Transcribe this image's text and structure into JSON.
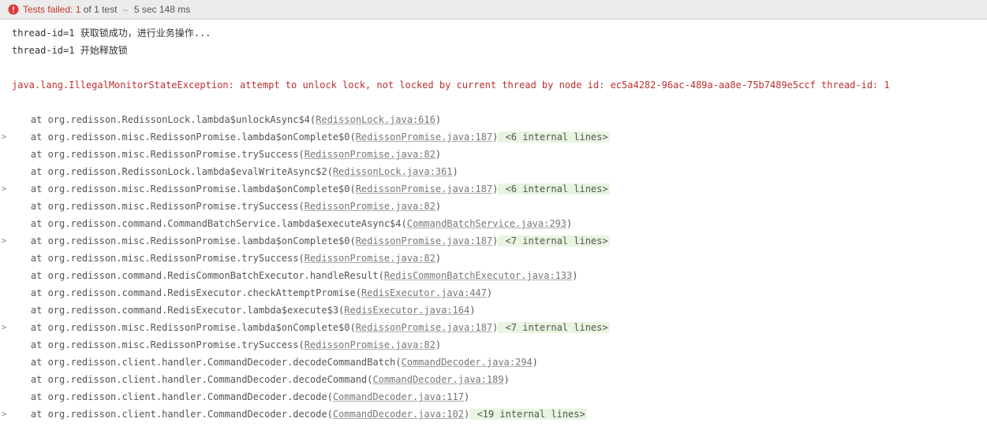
{
  "header": {
    "failed_label": "Tests failed:",
    "failed_count": "1",
    "of_label": "of 1 test",
    "time": "5 sec 148 ms"
  },
  "logs": [
    "thread-id=1 获取锁成功，进行业务操作...",
    "thread-id=1 开始释放锁"
  ],
  "exception": "java.lang.IllegalMonitorStateException: attempt to unlock lock, not locked by current thread by node id: ec5a4282-96ac-489a-aa8e-75b7489e5ccf thread-id: 1",
  "trace": [
    {
      "indent": "    ",
      "expand": "",
      "method": "at org.redisson.RedissonLock.lambda$unlockAsync$4(",
      "link": "RedissonLock.java:616",
      "after": ")",
      "internal": ""
    },
    {
      "indent": "    ",
      "expand": ">",
      "method": "at org.redisson.misc.RedissonPromise.lambda$onComplete$0(",
      "link": "RedissonPromise.java:187",
      "after": ")",
      "internal": " <6 internal lines>"
    },
    {
      "indent": "    ",
      "expand": "",
      "method": "at org.redisson.misc.RedissonPromise.trySuccess(",
      "link": "RedissonPromise.java:82",
      "after": ")",
      "internal": ""
    },
    {
      "indent": "    ",
      "expand": "",
      "method": "at org.redisson.RedissonLock.lambda$evalWriteAsync$2(",
      "link": "RedissonLock.java:361",
      "after": ")",
      "internal": ""
    },
    {
      "indent": "    ",
      "expand": ">",
      "method": "at org.redisson.misc.RedissonPromise.lambda$onComplete$0(",
      "link": "RedissonPromise.java:187",
      "after": ")",
      "internal": " <6 internal lines>"
    },
    {
      "indent": "    ",
      "expand": "",
      "method": "at org.redisson.misc.RedissonPromise.trySuccess(",
      "link": "RedissonPromise.java:82",
      "after": ")",
      "internal": ""
    },
    {
      "indent": "    ",
      "expand": "",
      "method": "at org.redisson.command.CommandBatchService.lambda$executeAsync$4(",
      "link": "CommandBatchService.java:293",
      "after": ")",
      "internal": ""
    },
    {
      "indent": "    ",
      "expand": ">",
      "method": "at org.redisson.misc.RedissonPromise.lambda$onComplete$0(",
      "link": "RedissonPromise.java:187",
      "after": ")",
      "internal": " <7 internal lines>"
    },
    {
      "indent": "    ",
      "expand": "",
      "method": "at org.redisson.misc.RedissonPromise.trySuccess(",
      "link": "RedissonPromise.java:82",
      "after": ")",
      "internal": ""
    },
    {
      "indent": "    ",
      "expand": "",
      "method": "at org.redisson.command.RedisCommonBatchExecutor.handleResult(",
      "link": "RedisCommonBatchExecutor.java:133",
      "after": ")",
      "internal": ""
    },
    {
      "indent": "    ",
      "expand": "",
      "method": "at org.redisson.command.RedisExecutor.checkAttemptPromise(",
      "link": "RedisExecutor.java:447",
      "after": ")",
      "internal": ""
    },
    {
      "indent": "    ",
      "expand": "",
      "method": "at org.redisson.command.RedisExecutor.lambda$execute$3(",
      "link": "RedisExecutor.java:164",
      "after": ")",
      "internal": ""
    },
    {
      "indent": "    ",
      "expand": ">",
      "method": "at org.redisson.misc.RedissonPromise.lambda$onComplete$0(",
      "link": "RedissonPromise.java:187",
      "after": ")",
      "internal": " <7 internal lines>"
    },
    {
      "indent": "    ",
      "expand": "",
      "method": "at org.redisson.misc.RedissonPromise.trySuccess(",
      "link": "RedissonPromise.java:82",
      "after": ")",
      "internal": ""
    },
    {
      "indent": "    ",
      "expand": "",
      "method": "at org.redisson.client.handler.CommandDecoder.decodeCommandBatch(",
      "link": "CommandDecoder.java:294",
      "after": ")",
      "internal": ""
    },
    {
      "indent": "    ",
      "expand": "",
      "method": "at org.redisson.client.handler.CommandDecoder.decodeCommand(",
      "link": "CommandDecoder.java:189",
      "after": ")",
      "internal": ""
    },
    {
      "indent": "    ",
      "expand": "",
      "method": "at org.redisson.client.handler.CommandDecoder.decode(",
      "link": "CommandDecoder.java:117",
      "after": ")",
      "internal": ""
    },
    {
      "indent": "    ",
      "expand": ">",
      "method": "at org.redisson.client.handler.CommandDecoder.decode(",
      "link": "CommandDecoder.java:102",
      "after": ")",
      "internal": " <19 internal lines>"
    }
  ]
}
